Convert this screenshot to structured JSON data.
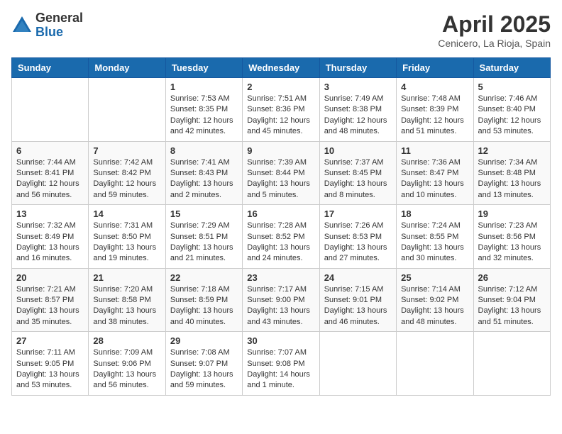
{
  "logo": {
    "general": "General",
    "blue": "Blue"
  },
  "title": "April 2025",
  "location": "Cenicero, La Rioja, Spain",
  "days_of_week": [
    "Sunday",
    "Monday",
    "Tuesday",
    "Wednesday",
    "Thursday",
    "Friday",
    "Saturday"
  ],
  "weeks": [
    [
      {
        "day": "",
        "sunrise": "",
        "sunset": "",
        "daylight": ""
      },
      {
        "day": "",
        "sunrise": "",
        "sunset": "",
        "daylight": ""
      },
      {
        "day": "1",
        "sunrise": "Sunrise: 7:53 AM",
        "sunset": "Sunset: 8:35 PM",
        "daylight": "Daylight: 12 hours and 42 minutes."
      },
      {
        "day": "2",
        "sunrise": "Sunrise: 7:51 AM",
        "sunset": "Sunset: 8:36 PM",
        "daylight": "Daylight: 12 hours and 45 minutes."
      },
      {
        "day": "3",
        "sunrise": "Sunrise: 7:49 AM",
        "sunset": "Sunset: 8:38 PM",
        "daylight": "Daylight: 12 hours and 48 minutes."
      },
      {
        "day": "4",
        "sunrise": "Sunrise: 7:48 AM",
        "sunset": "Sunset: 8:39 PM",
        "daylight": "Daylight: 12 hours and 51 minutes."
      },
      {
        "day": "5",
        "sunrise": "Sunrise: 7:46 AM",
        "sunset": "Sunset: 8:40 PM",
        "daylight": "Daylight: 12 hours and 53 minutes."
      }
    ],
    [
      {
        "day": "6",
        "sunrise": "Sunrise: 7:44 AM",
        "sunset": "Sunset: 8:41 PM",
        "daylight": "Daylight: 12 hours and 56 minutes."
      },
      {
        "day": "7",
        "sunrise": "Sunrise: 7:42 AM",
        "sunset": "Sunset: 8:42 PM",
        "daylight": "Daylight: 12 hours and 59 minutes."
      },
      {
        "day": "8",
        "sunrise": "Sunrise: 7:41 AM",
        "sunset": "Sunset: 8:43 PM",
        "daylight": "Daylight: 13 hours and 2 minutes."
      },
      {
        "day": "9",
        "sunrise": "Sunrise: 7:39 AM",
        "sunset": "Sunset: 8:44 PM",
        "daylight": "Daylight: 13 hours and 5 minutes."
      },
      {
        "day": "10",
        "sunrise": "Sunrise: 7:37 AM",
        "sunset": "Sunset: 8:45 PM",
        "daylight": "Daylight: 13 hours and 8 minutes."
      },
      {
        "day": "11",
        "sunrise": "Sunrise: 7:36 AM",
        "sunset": "Sunset: 8:47 PM",
        "daylight": "Daylight: 13 hours and 10 minutes."
      },
      {
        "day": "12",
        "sunrise": "Sunrise: 7:34 AM",
        "sunset": "Sunset: 8:48 PM",
        "daylight": "Daylight: 13 hours and 13 minutes."
      }
    ],
    [
      {
        "day": "13",
        "sunrise": "Sunrise: 7:32 AM",
        "sunset": "Sunset: 8:49 PM",
        "daylight": "Daylight: 13 hours and 16 minutes."
      },
      {
        "day": "14",
        "sunrise": "Sunrise: 7:31 AM",
        "sunset": "Sunset: 8:50 PM",
        "daylight": "Daylight: 13 hours and 19 minutes."
      },
      {
        "day": "15",
        "sunrise": "Sunrise: 7:29 AM",
        "sunset": "Sunset: 8:51 PM",
        "daylight": "Daylight: 13 hours and 21 minutes."
      },
      {
        "day": "16",
        "sunrise": "Sunrise: 7:28 AM",
        "sunset": "Sunset: 8:52 PM",
        "daylight": "Daylight: 13 hours and 24 minutes."
      },
      {
        "day": "17",
        "sunrise": "Sunrise: 7:26 AM",
        "sunset": "Sunset: 8:53 PM",
        "daylight": "Daylight: 13 hours and 27 minutes."
      },
      {
        "day": "18",
        "sunrise": "Sunrise: 7:24 AM",
        "sunset": "Sunset: 8:55 PM",
        "daylight": "Daylight: 13 hours and 30 minutes."
      },
      {
        "day": "19",
        "sunrise": "Sunrise: 7:23 AM",
        "sunset": "Sunset: 8:56 PM",
        "daylight": "Daylight: 13 hours and 32 minutes."
      }
    ],
    [
      {
        "day": "20",
        "sunrise": "Sunrise: 7:21 AM",
        "sunset": "Sunset: 8:57 PM",
        "daylight": "Daylight: 13 hours and 35 minutes."
      },
      {
        "day": "21",
        "sunrise": "Sunrise: 7:20 AM",
        "sunset": "Sunset: 8:58 PM",
        "daylight": "Daylight: 13 hours and 38 minutes."
      },
      {
        "day": "22",
        "sunrise": "Sunrise: 7:18 AM",
        "sunset": "Sunset: 8:59 PM",
        "daylight": "Daylight: 13 hours and 40 minutes."
      },
      {
        "day": "23",
        "sunrise": "Sunrise: 7:17 AM",
        "sunset": "Sunset: 9:00 PM",
        "daylight": "Daylight: 13 hours and 43 minutes."
      },
      {
        "day": "24",
        "sunrise": "Sunrise: 7:15 AM",
        "sunset": "Sunset: 9:01 PM",
        "daylight": "Daylight: 13 hours and 46 minutes."
      },
      {
        "day": "25",
        "sunrise": "Sunrise: 7:14 AM",
        "sunset": "Sunset: 9:02 PM",
        "daylight": "Daylight: 13 hours and 48 minutes."
      },
      {
        "day": "26",
        "sunrise": "Sunrise: 7:12 AM",
        "sunset": "Sunset: 9:04 PM",
        "daylight": "Daylight: 13 hours and 51 minutes."
      }
    ],
    [
      {
        "day": "27",
        "sunrise": "Sunrise: 7:11 AM",
        "sunset": "Sunset: 9:05 PM",
        "daylight": "Daylight: 13 hours and 53 minutes."
      },
      {
        "day": "28",
        "sunrise": "Sunrise: 7:09 AM",
        "sunset": "Sunset: 9:06 PM",
        "daylight": "Daylight: 13 hours and 56 minutes."
      },
      {
        "day": "29",
        "sunrise": "Sunrise: 7:08 AM",
        "sunset": "Sunset: 9:07 PM",
        "daylight": "Daylight: 13 hours and 59 minutes."
      },
      {
        "day": "30",
        "sunrise": "Sunrise: 7:07 AM",
        "sunset": "Sunset: 9:08 PM",
        "daylight": "Daylight: 14 hours and 1 minute."
      },
      {
        "day": "",
        "sunrise": "",
        "sunset": "",
        "daylight": ""
      },
      {
        "day": "",
        "sunrise": "",
        "sunset": "",
        "daylight": ""
      },
      {
        "day": "",
        "sunrise": "",
        "sunset": "",
        "daylight": ""
      }
    ]
  ]
}
